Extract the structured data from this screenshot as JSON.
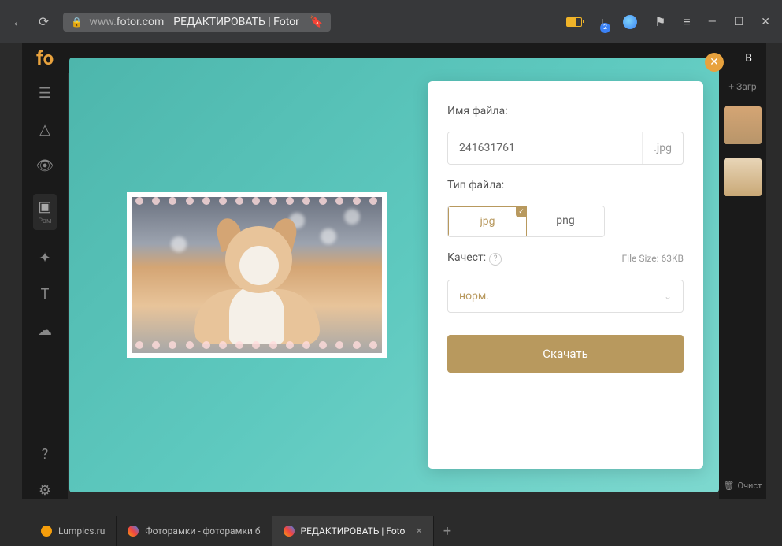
{
  "browser": {
    "url_prefix": "www.",
    "url_domain": "fotor.com",
    "page_title": "РЕДАКТИРОВАТЬ | Fotor",
    "download_count": "2"
  },
  "app": {
    "logo": "fo",
    "header_right": "В",
    "sidebar_active_label": "Рам",
    "add_button": "+ Загр",
    "clear_button": "Очист"
  },
  "modal": {
    "filename_label": "Имя файла:",
    "filename_value": "241631761",
    "filename_ext": ".jpg",
    "type_label": "Тип файла:",
    "type_jpg": "jpg",
    "type_png": "png",
    "quality_label": "Качест:",
    "filesize": "File Size: 63KB",
    "quality_value": "норм.",
    "download_button": "Скачать"
  },
  "tabs": {
    "t1": "Lumpics.ru",
    "t2": "Фоторамки - фоторамки б",
    "t3": "РЕДАКТИРОВАТЬ | Foto"
  }
}
